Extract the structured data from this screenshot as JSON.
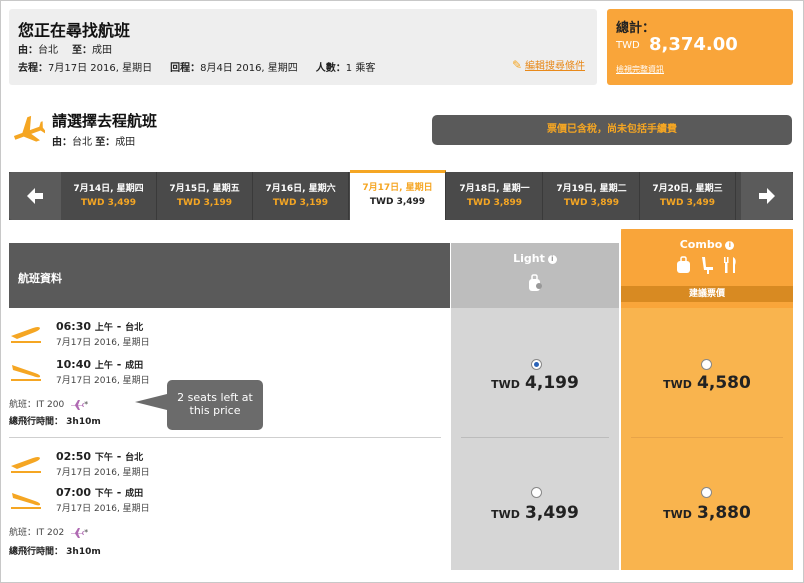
{
  "search": {
    "title": "您正在尋找航班",
    "from_label": "由：",
    "from": "台北",
    "to_label": "至：",
    "to": "成田",
    "depart_label": "去程：",
    "depart_date": "7月17日 2016, 星期日",
    "return_label": "回程：",
    "return_date": "8月4日 2016, 星期四",
    "pax_label": "人數：",
    "pax": "1 乘客",
    "edit_label": "編輯搜尋條件"
  },
  "total": {
    "label": "總計：",
    "currency": "TWD",
    "amount": "8,374.00",
    "detail_link": "檢視完整資訊"
  },
  "outbound": {
    "title": "請選擇去程航班",
    "route_from_label": "由：",
    "route_from": "台北",
    "route_to_label": "至：",
    "route_to": "成田",
    "tax_note": "票價已含稅，尚未包括手續費"
  },
  "date_strip": [
    {
      "date": "7月14日, 星期四",
      "price": "TWD 3,499",
      "selected": false
    },
    {
      "date": "7月15日, 星期五",
      "price": "TWD 3,199",
      "selected": false
    },
    {
      "date": "7月16日, 星期六",
      "price": "TWD 3,199",
      "selected": false
    },
    {
      "date": "7月17日, 星期日",
      "price": "TWD 3,499",
      "selected": true
    },
    {
      "date": "7月18日, 星期一",
      "price": "TWD 3,899",
      "selected": false
    },
    {
      "date": "7月19日, 星期二",
      "price": "TWD 3,899",
      "selected": false
    },
    {
      "date": "7月20日, 星期三",
      "price": "TWD 3,499",
      "selected": false
    }
  ],
  "table": {
    "info_header": "航班資料",
    "light_name": "Light",
    "combo_name": "Combo",
    "combo_recommend": "建議票價"
  },
  "flights": [
    {
      "dep_time": "06:30",
      "dep_period": "上午",
      "dep_city": "台北",
      "dep_date": "7月17日 2016, 星期日",
      "arr_time": "10:40",
      "arr_period": "上午",
      "arr_city": "成田",
      "arr_date": "7月17日 2016, 星期日",
      "flight_label": "航班：",
      "flight_no": "IT 200",
      "duration_label": "總飛行時間：",
      "duration": "3h10m",
      "light_currency": "TWD",
      "light_price": "4,199",
      "light_selected": true,
      "combo_currency": "TWD",
      "combo_price": "4,580",
      "combo_selected": false
    },
    {
      "dep_time": "02:50",
      "dep_period": "下午",
      "dep_city": "台北",
      "dep_date": "7月17日 2016, 星期日",
      "arr_time": "07:00",
      "arr_period": "下午",
      "arr_city": "成田",
      "arr_date": "7月17日 2016, 星期日",
      "flight_label": "航班：",
      "flight_no": "IT 202",
      "duration_label": "總飛行時間：",
      "duration": "3h10m",
      "light_currency": "TWD",
      "light_price": "3,499",
      "light_selected": false,
      "combo_currency": "TWD",
      "combo_price": "3,880",
      "combo_selected": false
    }
  ],
  "tooltip": "2 seats left at this price",
  "colors": {
    "accent": "#f9a53a",
    "dark_bar": "#4a4a4a",
    "light_col": "#d6d6d6",
    "combo_col": "#f9b44e"
  }
}
